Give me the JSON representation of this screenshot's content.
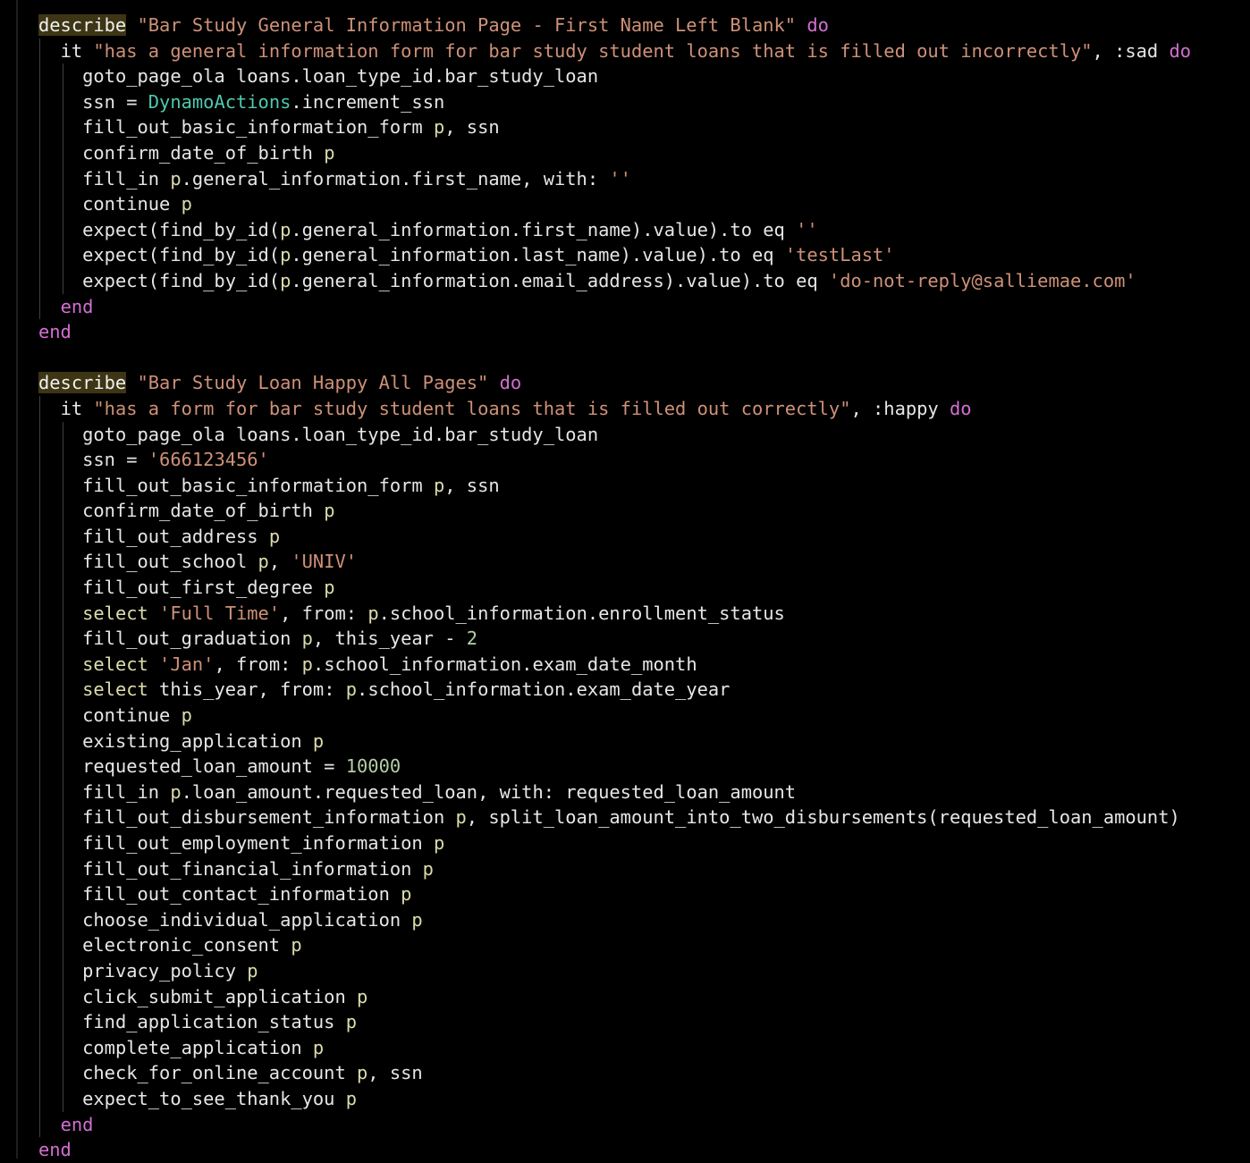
{
  "editor": {
    "colors": {
      "background": "#000000",
      "keyword": "#d270d2",
      "string": "#ce9178",
      "number": "#b5cea8",
      "class": "#4ec9b0",
      "parameter": "#dcdcaa",
      "text": "#e6e6e6",
      "describe_highlight": "#3d3513"
    },
    "lines": [
      {
        "indent": 0,
        "tokens": [
          [
            "kw-hl",
            "describe"
          ],
          [
            "plain",
            " "
          ],
          [
            "str",
            "\"Bar Study General Information Page - First Name Left Blank\""
          ],
          [
            "plain",
            " "
          ],
          [
            "kw",
            "do"
          ]
        ]
      },
      {
        "indent": 1,
        "tokens": [
          [
            "plain",
            "it "
          ],
          [
            "str",
            "\"has a general information form for bar study student loans that is filled out incorrectly\""
          ],
          [
            "plain",
            ", :sad "
          ],
          [
            "kw",
            "do"
          ]
        ]
      },
      {
        "indent": 2,
        "tokens": [
          [
            "plain",
            "goto_page_ola loans.loan_type_id.bar_study_loan"
          ]
        ]
      },
      {
        "indent": 2,
        "tokens": [
          [
            "plain",
            "ssn = "
          ],
          [
            "cls",
            "DynamoActions"
          ],
          [
            "plain",
            ".increment_ssn"
          ]
        ]
      },
      {
        "indent": 2,
        "tokens": [
          [
            "plain",
            "fill_out_basic_information_form "
          ],
          [
            "fn",
            "p"
          ],
          [
            "plain",
            ", ssn"
          ]
        ]
      },
      {
        "indent": 2,
        "tokens": [
          [
            "plain",
            "confirm_date_of_birth "
          ],
          [
            "fn",
            "p"
          ]
        ]
      },
      {
        "indent": 2,
        "tokens": [
          [
            "plain",
            "fill_in "
          ],
          [
            "fn",
            "p"
          ],
          [
            "plain",
            ".general_information.first_name, with: "
          ],
          [
            "str",
            "''"
          ]
        ]
      },
      {
        "indent": 2,
        "tokens": [
          [
            "plain",
            "continue "
          ],
          [
            "fn",
            "p"
          ]
        ]
      },
      {
        "indent": 2,
        "tokens": [
          [
            "plain",
            "expect(find_by_id("
          ],
          [
            "fn",
            "p"
          ],
          [
            "plain",
            ".general_information.first_name).value).to eq "
          ],
          [
            "str",
            "''"
          ]
        ]
      },
      {
        "indent": 2,
        "tokens": [
          [
            "plain",
            "expect(find_by_id("
          ],
          [
            "fn",
            "p"
          ],
          [
            "plain",
            ".general_information.last_name).value).to eq "
          ],
          [
            "str",
            "'testLast'"
          ]
        ]
      },
      {
        "indent": 2,
        "tokens": [
          [
            "plain",
            "expect(find_by_id("
          ],
          [
            "fn",
            "p"
          ],
          [
            "plain",
            ".general_information.email_address).value).to eq "
          ],
          [
            "str",
            "'do-not-reply@salliemae.com'"
          ]
        ]
      },
      {
        "indent": 1,
        "tokens": [
          [
            "kw",
            "end"
          ]
        ]
      },
      {
        "indent": 0,
        "tokens": [
          [
            "kw",
            "end"
          ]
        ]
      },
      {
        "indent": 0,
        "tokens": []
      },
      {
        "indent": 0,
        "tokens": [
          [
            "kw-hl",
            "describe"
          ],
          [
            "plain",
            " "
          ],
          [
            "str",
            "\"Bar Study Loan Happy All Pages\""
          ],
          [
            "plain",
            " "
          ],
          [
            "kw",
            "do"
          ]
        ]
      },
      {
        "indent": 1,
        "tokens": [
          [
            "plain",
            "it "
          ],
          [
            "str",
            "\"has a form for bar study student loans that is filled out correctly\""
          ],
          [
            "plain",
            ", :happy "
          ],
          [
            "kw",
            "do"
          ]
        ]
      },
      {
        "indent": 2,
        "tokens": [
          [
            "plain",
            "goto_page_ola loans.loan_type_id.bar_study_loan"
          ]
        ]
      },
      {
        "indent": 2,
        "tokens": [
          [
            "plain",
            "ssn = "
          ],
          [
            "str",
            "'666123456'"
          ]
        ]
      },
      {
        "indent": 2,
        "tokens": [
          [
            "plain",
            "fill_out_basic_information_form "
          ],
          [
            "fn",
            "p"
          ],
          [
            "plain",
            ", ssn"
          ]
        ]
      },
      {
        "indent": 2,
        "tokens": [
          [
            "plain",
            "confirm_date_of_birth "
          ],
          [
            "fn",
            "p"
          ]
        ]
      },
      {
        "indent": 2,
        "tokens": [
          [
            "plain",
            "fill_out_address "
          ],
          [
            "fn",
            "p"
          ]
        ]
      },
      {
        "indent": 2,
        "tokens": [
          [
            "plain",
            "fill_out_school "
          ],
          [
            "fn",
            "p"
          ],
          [
            "plain",
            ", "
          ],
          [
            "str",
            "'UNIV'"
          ]
        ]
      },
      {
        "indent": 2,
        "tokens": [
          [
            "plain",
            "fill_out_first_degree "
          ],
          [
            "fn",
            "p"
          ]
        ]
      },
      {
        "indent": 2,
        "tokens": [
          [
            "fn",
            "select "
          ],
          [
            "str",
            "'Full Time'"
          ],
          [
            "plain",
            ", from: "
          ],
          [
            "fn",
            "p"
          ],
          [
            "plain",
            ".school_information.enrollment_status"
          ]
        ]
      },
      {
        "indent": 2,
        "tokens": [
          [
            "plain",
            "fill_out_graduation "
          ],
          [
            "fn",
            "p"
          ],
          [
            "plain",
            ", this_year - "
          ],
          [
            "num",
            "2"
          ]
        ]
      },
      {
        "indent": 2,
        "tokens": [
          [
            "fn",
            "select "
          ],
          [
            "str",
            "'Jan'"
          ],
          [
            "plain",
            ", from: "
          ],
          [
            "fn",
            "p"
          ],
          [
            "plain",
            ".school_information.exam_date_month"
          ]
        ]
      },
      {
        "indent": 2,
        "tokens": [
          [
            "fn",
            "select"
          ],
          [
            "plain",
            " this_year, from: "
          ],
          [
            "fn",
            "p"
          ],
          [
            "plain",
            ".school_information.exam_date_year"
          ]
        ]
      },
      {
        "indent": 2,
        "tokens": [
          [
            "plain",
            "continue "
          ],
          [
            "fn",
            "p"
          ]
        ]
      },
      {
        "indent": 2,
        "tokens": [
          [
            "plain",
            "existing_application "
          ],
          [
            "fn",
            "p"
          ]
        ]
      },
      {
        "indent": 2,
        "tokens": [
          [
            "plain",
            "requested_loan_amount = "
          ],
          [
            "num",
            "10000"
          ]
        ]
      },
      {
        "indent": 2,
        "tokens": [
          [
            "plain",
            "fill_in "
          ],
          [
            "fn",
            "p"
          ],
          [
            "plain",
            ".loan_amount.requested_loan, with: requested_loan_amount"
          ]
        ]
      },
      {
        "indent": 2,
        "tokens": [
          [
            "plain",
            "fill_out_disbursement_information "
          ],
          [
            "fn",
            "p"
          ],
          [
            "plain",
            ", split_loan_amount_into_two_disbursements(requested_loan_amount)"
          ]
        ]
      },
      {
        "indent": 2,
        "tokens": [
          [
            "plain",
            "fill_out_employment_information "
          ],
          [
            "fn",
            "p"
          ]
        ]
      },
      {
        "indent": 2,
        "tokens": [
          [
            "plain",
            "fill_out_financial_information "
          ],
          [
            "fn",
            "p"
          ]
        ]
      },
      {
        "indent": 2,
        "tokens": [
          [
            "plain",
            "fill_out_contact_information "
          ],
          [
            "fn",
            "p"
          ]
        ]
      },
      {
        "indent": 2,
        "tokens": [
          [
            "plain",
            "choose_individual_application "
          ],
          [
            "fn",
            "p"
          ]
        ]
      },
      {
        "indent": 2,
        "tokens": [
          [
            "plain",
            "electronic_consent "
          ],
          [
            "fn",
            "p"
          ]
        ]
      },
      {
        "indent": 2,
        "tokens": [
          [
            "plain",
            "privacy_policy "
          ],
          [
            "fn",
            "p"
          ]
        ]
      },
      {
        "indent": 2,
        "tokens": [
          [
            "plain",
            "click_submit_application "
          ],
          [
            "fn",
            "p"
          ]
        ]
      },
      {
        "indent": 2,
        "tokens": [
          [
            "plain",
            "find_application_status "
          ],
          [
            "fn",
            "p"
          ]
        ]
      },
      {
        "indent": 2,
        "tokens": [
          [
            "plain",
            "complete_application "
          ],
          [
            "fn",
            "p"
          ]
        ]
      },
      {
        "indent": 2,
        "tokens": [
          [
            "plain",
            "check_for_online_account "
          ],
          [
            "fn",
            "p"
          ],
          [
            "plain",
            ", ssn"
          ]
        ]
      },
      {
        "indent": 2,
        "tokens": [
          [
            "plain",
            "expect_to_see_thank_you "
          ],
          [
            "fn",
            "p"
          ]
        ]
      },
      {
        "indent": 1,
        "tokens": [
          [
            "kw",
            "end"
          ]
        ]
      },
      {
        "indent": 0,
        "tokens": [
          [
            "kw",
            "end"
          ]
        ]
      }
    ]
  }
}
